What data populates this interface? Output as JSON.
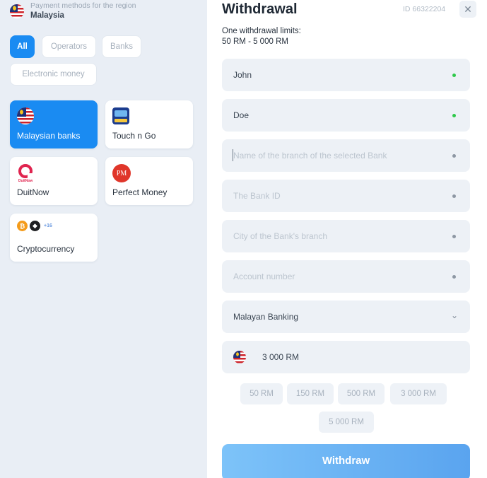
{
  "region": {
    "sub": "Payment methods for the region",
    "name": "Malaysia",
    "flag_icon": "malaysia-flag-icon"
  },
  "filters": [
    {
      "label": "All",
      "active": true
    },
    {
      "label": "Operators",
      "active": false
    },
    {
      "label": "Banks",
      "active": false
    },
    {
      "label": "Electronic money",
      "active": false
    }
  ],
  "methods": [
    {
      "label": "Malaysian banks",
      "icon": "malaysia-flag-icon",
      "active": true
    },
    {
      "label": "Touch n Go",
      "icon": "touch-n-go-icon",
      "active": false
    },
    {
      "label": "DuitNow",
      "icon": "duitnow-icon",
      "icon_text": "DuitNow",
      "active": false
    },
    {
      "label": "Perfect Money",
      "icon": "perfect-money-icon",
      "icon_text": "PM",
      "active": false
    },
    {
      "label": "Cryptocurrency",
      "icon": "crypto-icon",
      "more_text": "+16",
      "active": false
    }
  ],
  "form": {
    "title": "Withdrawal",
    "id_text": "ID 66322204",
    "close_symbol": "✕",
    "limits_line1": "One withdrawal limits:",
    "limits_line2": "50 RM - 5 000 RM",
    "first_name": "John",
    "last_name": "Doe",
    "branch_placeholder": "Name of the branch of the selected Bank",
    "bank_id_placeholder": "The Bank ID",
    "city_placeholder": "City of the Bank's branch",
    "account_placeholder": "Account number",
    "bank_select": "Malayan Banking",
    "amount": "3 000 RM",
    "quick_amounts": [
      "50 RM",
      "150 RM",
      "500 RM",
      "3 000 RM",
      "5 000 RM"
    ],
    "submit_label": "Withdraw"
  },
  "colors": {
    "accent": "#1a8bf2",
    "valid": "#2ec94a",
    "panel_bg": "#e9eef5",
    "field_bg": "#edf1f6"
  }
}
